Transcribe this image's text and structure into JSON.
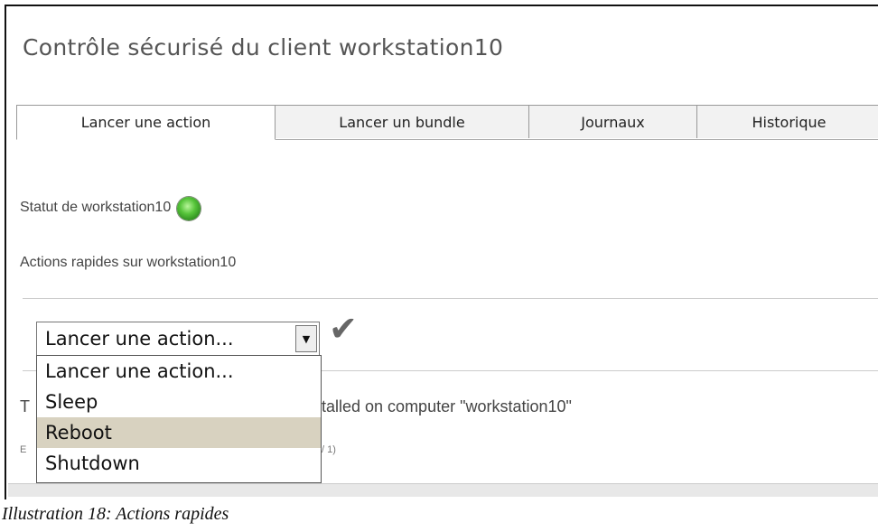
{
  "page": {
    "title": "Contrôle sécurisé du client workstation10"
  },
  "tabs": [
    {
      "label": "Lancer une action",
      "active": true
    },
    {
      "label": "Lancer un bundle",
      "active": false
    },
    {
      "label": "Journaux",
      "active": false
    },
    {
      "label": "Historique",
      "active": false
    }
  ],
  "status": {
    "label": "Statut de workstation10",
    "indicator_color": "#56c43a",
    "indicator_icon": "status-led-icon"
  },
  "quick_actions": {
    "title": "Actions rapides sur workstation10",
    "select_value": "Lancer une action...",
    "confirm_icon": "checkmark-icon",
    "options": [
      "Lancer une action...",
      "Sleep",
      "Reboot",
      "Shutdown"
    ],
    "highlighted_option": "Reboot"
  },
  "background": {
    "line1_visible_start": "T",
    "line1_visible_rest": "talled on computer \"workstation10\"",
    "line2_visible_start": "E",
    "line2_visible_rest": "/ 1)"
  },
  "caption": "Illustration 18: Actions rapides"
}
